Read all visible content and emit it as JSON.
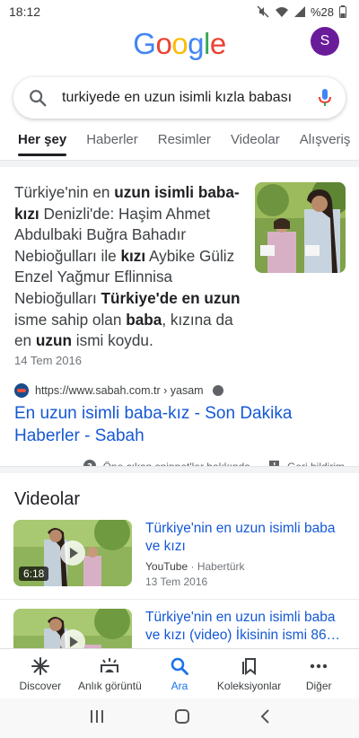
{
  "status_bar": {
    "time": "18:12",
    "battery": "%28"
  },
  "header": {
    "logo_letters": [
      {
        "ch": "G",
        "color": "#4285F4"
      },
      {
        "ch": "o",
        "color": "#EA4335"
      },
      {
        "ch": "o",
        "color": "#FBBC05"
      },
      {
        "ch": "g",
        "color": "#4285F4"
      },
      {
        "ch": "l",
        "color": "#34A853"
      },
      {
        "ch": "e",
        "color": "#EA4335"
      }
    ],
    "avatar_letter": "S",
    "avatar_color": "#6A1B9A"
  },
  "search": {
    "query": "turkiyede en uzun isimli kızla babası"
  },
  "tabs": [
    {
      "label": "Her şey",
      "active": true
    },
    {
      "label": "Haberler",
      "active": false
    },
    {
      "label": "Resimler",
      "active": false
    },
    {
      "label": "Videolar",
      "active": false
    },
    {
      "label": "Alışveriş",
      "active": false
    }
  ],
  "snippet": {
    "segments": [
      {
        "text": "Türkiye'nin en ",
        "bold": false
      },
      {
        "text": "uzun isimli baba-kızı",
        "bold": true
      },
      {
        "text": " Denizli'de: Haşim Ahmet Abdulbaki Buğra Bahadır Nebioğulları ile ",
        "bold": false
      },
      {
        "text": "kızı",
        "bold": true
      },
      {
        "text": " Aybike Güliz Enzel Yağmur Eflinnisa Nebioğulları ",
        "bold": false
      },
      {
        "text": "Türkiye'de en uzun",
        "bold": true
      },
      {
        "text": " isme sahip olan ",
        "bold": false
      },
      {
        "text": "baba",
        "bold": true
      },
      {
        "text": ", kızına da en ",
        "bold": false
      },
      {
        "text": "uzun",
        "bold": true
      },
      {
        "text": " ismi koydu.",
        "bold": false
      }
    ],
    "date": "14 Tem 2016",
    "source_url": "https://www.sabah.com.tr › yasam",
    "link_title": "En uzun isimli baba-kız - Son Dakika Haberler - Sabah",
    "footer_about": "Öne çıkan snippet'ler hakkında",
    "footer_feedback": "Geri bildirim"
  },
  "videos": {
    "section_title": "Videolar",
    "items": [
      {
        "title": "Türkiye'nin en uzun isimli baba ve kızı",
        "source": "YouTube",
        "channel": "Habertürk",
        "date": "13 Tem 2016",
        "duration": "6:18"
      },
      {
        "title": "Türkiye'nin en uzun isimli baba ve kızı (video) İkisinin ismi 86…",
        "source": "",
        "channel": "",
        "date": "",
        "duration": ""
      }
    ]
  },
  "bottom_nav": [
    {
      "label": "Discover",
      "icon": "asterisk-icon",
      "active": false
    },
    {
      "label": "Anlık görüntü",
      "icon": "snapshot-icon",
      "active": false
    },
    {
      "label": "Ara",
      "icon": "search-icon",
      "active": true
    },
    {
      "label": "Koleksiyonlar",
      "icon": "bookmark-icon",
      "active": false
    },
    {
      "label": "Diğer",
      "icon": "more-icon",
      "active": false
    }
  ],
  "colors": {
    "link": "#1558D6",
    "active_nav": "#1A73E8",
    "text": "#202124",
    "muted": "#70757A"
  }
}
